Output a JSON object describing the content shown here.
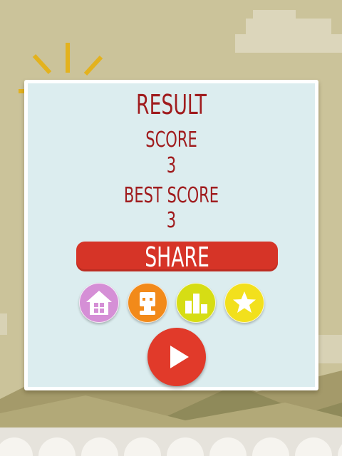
{
  "result": {
    "title": "RESULT",
    "score_label": "SCORE",
    "score_value": "3",
    "best_label": "BEST SCORE",
    "best_value": "3"
  },
  "buttons": {
    "share_label": "SHARE"
  },
  "icons": {
    "home": "home-icon",
    "character": "character-icon",
    "leaderboard": "leaderboard-icon",
    "rate": "star-icon",
    "play": "play-icon"
  },
  "colors": {
    "background": "#cbc39a",
    "panel": "#dcedef",
    "text": "#a01c1e",
    "share": "#d63427",
    "home": "#d58fd6",
    "character": "#f28a1a",
    "leaderboard": "#d6dd14",
    "rate": "#f2e01d",
    "play": "#e13a2a"
  }
}
